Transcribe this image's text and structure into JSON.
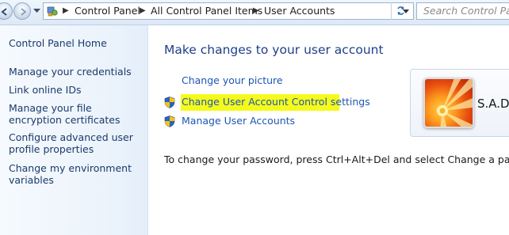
{
  "breadcrumbs": [
    "Control Panel",
    "All Control Panel Items",
    "User Accounts"
  ],
  "search": {
    "placeholder": "Search Control Panel"
  },
  "sidebar": {
    "home": "Control Panel Home",
    "items": [
      "Manage your credentials",
      "Link online IDs",
      "Manage your file encryption certificates",
      "Configure advanced user profile properties",
      "Change my environment variables"
    ]
  },
  "main": {
    "title": "Make changes to your user account",
    "tasks": [
      {
        "label": "Change your picture",
        "icon": "none"
      },
      {
        "label": "Change User Account Control settings",
        "icon": "uac-shield-icon",
        "highlighted": true
      },
      {
        "label": "Manage User Accounts",
        "icon": "uac-shield-icon"
      }
    ],
    "password_note": "To change your password, press Ctrl+Alt+Del and select Change a password."
  },
  "user": {
    "name": "S.A.De"
  },
  "colors": {
    "link": "#1d56b3",
    "title": "#1e3f88",
    "highlight": "#f5fa1c",
    "sidebar_link": "#1b3a6b"
  }
}
